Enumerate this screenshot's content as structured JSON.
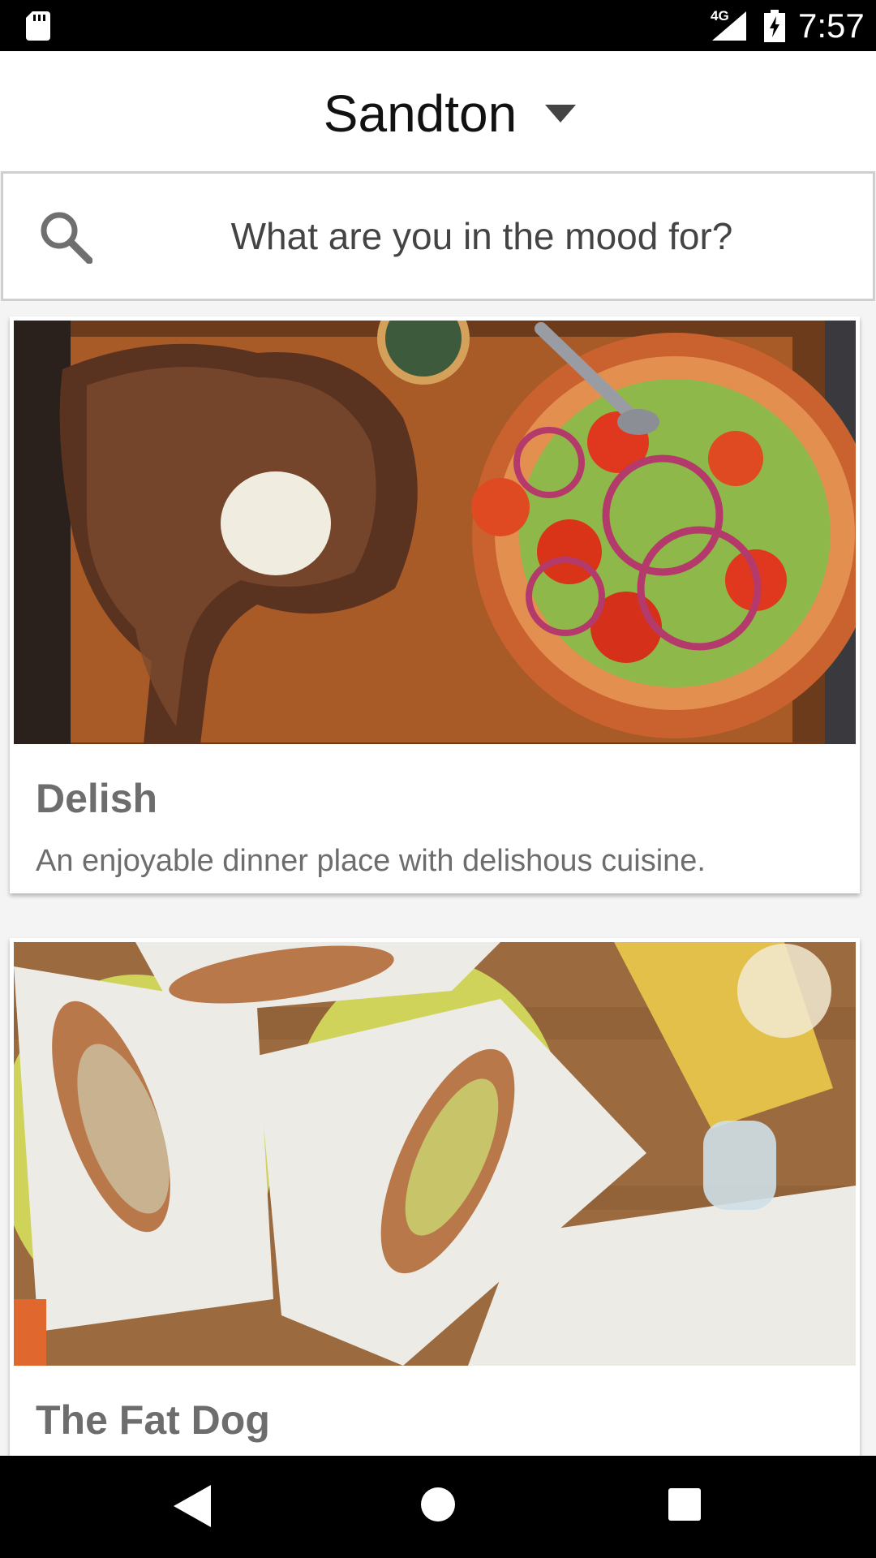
{
  "status_bar": {
    "network": "4G",
    "time": "7:57"
  },
  "header": {
    "location": "Sandton"
  },
  "search": {
    "placeholder": "What are you in the mood for?"
  },
  "restaurants": [
    {
      "name": "Delish",
      "description": "An enjoyable dinner place with delishous cuisine."
    },
    {
      "name": "The Fat Dog"
    }
  ],
  "icons": {
    "sd_card": "sd-card-icon",
    "signal": "signal-icon",
    "battery": "battery-charging-icon",
    "dropdown": "chevron-down-icon",
    "search": "search-icon",
    "back": "back-icon",
    "home": "home-icon",
    "recents": "recents-icon"
  }
}
